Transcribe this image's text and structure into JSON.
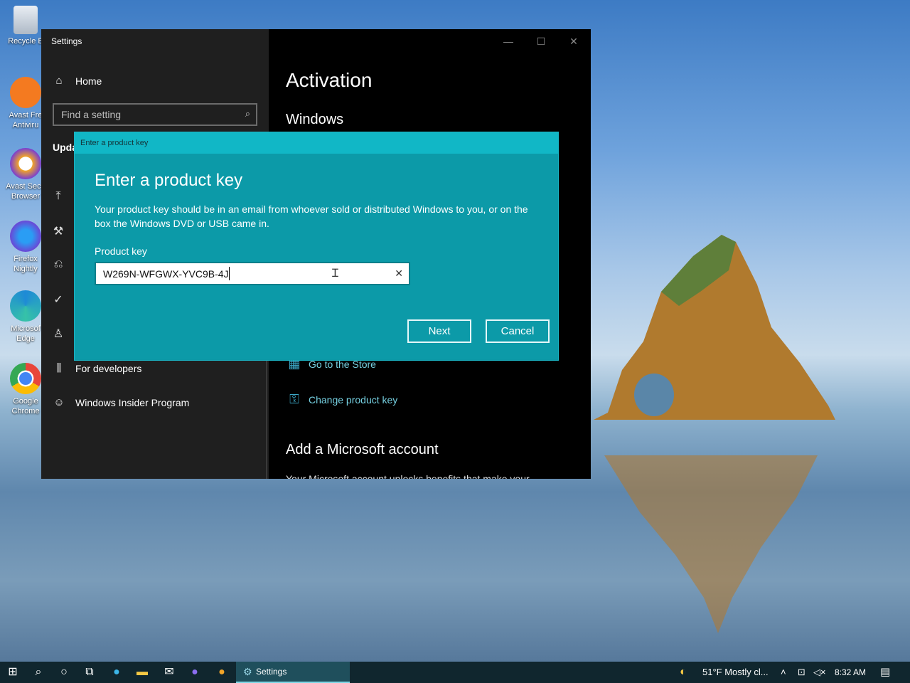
{
  "desktop": {
    "icons": [
      {
        "label": "Recycle B",
        "name": "recycle-bin",
        "color": "#cfd8e3"
      },
      {
        "label": "Avast Free Antivirus",
        "line1": "Avast Fre",
        "line2": "Antiviru",
        "color": "#f47a20"
      },
      {
        "label": "Avast Secure Browser",
        "line1": "Avast Secu",
        "line2": "Browser",
        "color": "#f1a428"
      },
      {
        "label": "Firefox Nightly",
        "line1": "Firefox",
        "line2": "Nightly",
        "color": "#6a47d6"
      },
      {
        "label": "Microsoft Edge",
        "line1": "Microsof",
        "line2": "Edge",
        "color": "#1e8ad6"
      },
      {
        "label": "Google Chrome",
        "line1": "Google",
        "line2": "Chrome",
        "color": "#e8463a"
      }
    ]
  },
  "settings": {
    "window_title": "Settings",
    "home_label": "Home",
    "search_placeholder": "Find a setting",
    "section_label_partial": "Upda",
    "nav_for_developers": "For developers",
    "nav_insider": "Windows Insider Program",
    "page_title": "Activation",
    "section_windows": "Windows",
    "link_store": "Go to the Store",
    "link_change_key": "Change product key",
    "add_account_heading": "Add a Microsoft account",
    "add_account_text": "Your Microsoft account unlocks benefits that make your"
  },
  "dialog": {
    "titlebar": "Enter a product key",
    "heading": "Enter a product key",
    "body": "Your product key should be in an email from whoever sold or distributed Windows to you, or on the box the Windows DVD or USB came in.",
    "field_label": "Product key",
    "field_value": "W269N-WFGWX-YVC9B-4J",
    "next_label": "Next",
    "cancel_label": "Cancel",
    "accent_color": "#0c9aa8"
  },
  "taskbar": {
    "active_app": "Settings",
    "weather": "51°F  Mostly cl...",
    "clock": "8:32 AM",
    "accent_color": "#10262e"
  }
}
